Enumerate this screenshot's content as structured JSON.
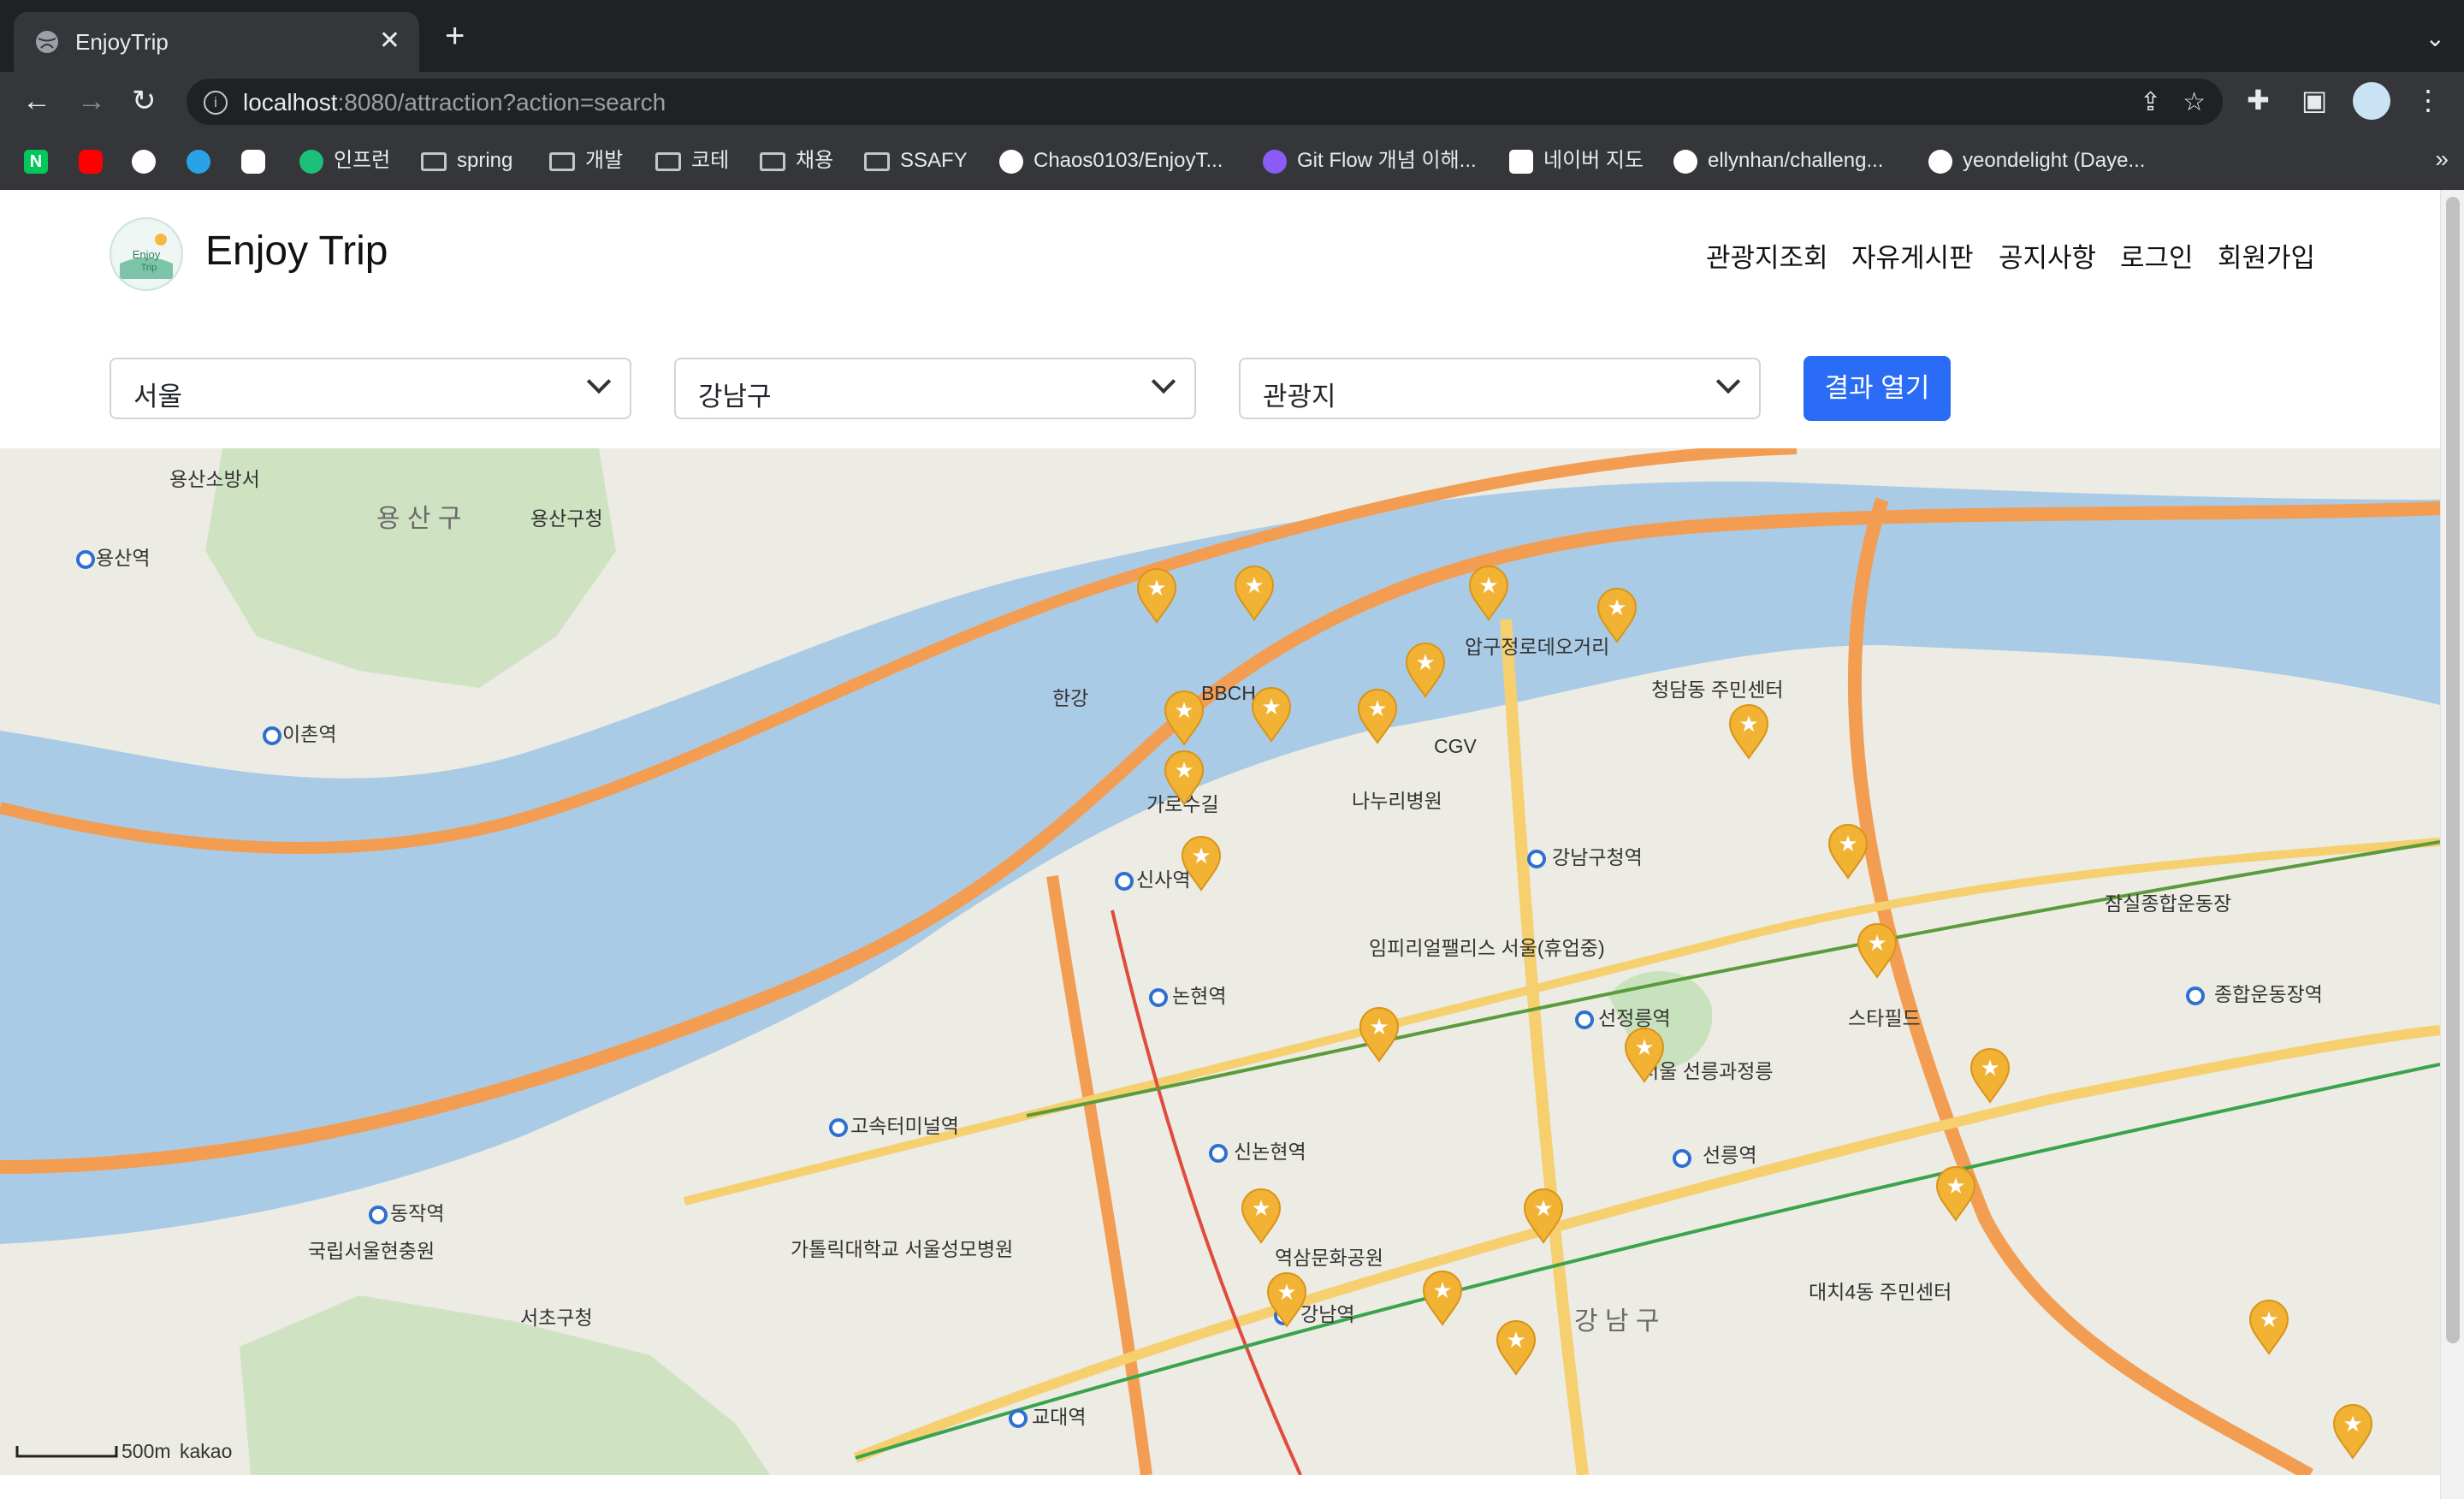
{
  "browser": {
    "tab_title": "EnjoyTrip",
    "url_host": "localhost",
    "url_path": ":8080/attraction?action=search",
    "bookmarks": [
      {
        "label": "",
        "icon": "naver-icon",
        "color": "#03c75a"
      },
      {
        "label": "",
        "icon": "youtube-icon",
        "color": "#ff0000"
      },
      {
        "label": "",
        "icon": "github-icon",
        "color": "#ffffff"
      },
      {
        "label": "",
        "icon": "edge-icon",
        "color": "#2aa3e6"
      },
      {
        "label": "",
        "icon": "app-icon",
        "color": "#ffffff"
      },
      {
        "label": "인프런",
        "icon": "inflearn-icon",
        "color": "#1dc078"
      },
      {
        "label": "spring",
        "icon": "folder-icon"
      },
      {
        "label": "개발",
        "icon": "folder-icon"
      },
      {
        "label": "코테",
        "icon": "folder-icon"
      },
      {
        "label": "채용",
        "icon": "folder-icon"
      },
      {
        "label": "SSAFY",
        "icon": "folder-icon"
      },
      {
        "label": "Chaos0103/EnjoyT...",
        "icon": "github-icon"
      },
      {
        "label": "Git Flow 개념 이해...",
        "icon": "git-icon"
      },
      {
        "label": "네이버 지도",
        "icon": "naver-map-icon"
      },
      {
        "label": "ellynhan/challeng...",
        "icon": "github-icon"
      },
      {
        "label": "yeondelight (Daye...",
        "icon": "github-icon"
      }
    ]
  },
  "site": {
    "title": "Enjoy Trip",
    "nav": [
      "관광지조회",
      "자유게시판",
      "공지사항",
      "로그인",
      "회원가입"
    ]
  },
  "filters": {
    "region": "서울",
    "district": "강남구",
    "content_type": "관광지",
    "submit_label": "결과 열기"
  },
  "map": {
    "provider": "kakao",
    "scale_label": "500m",
    "area_labels": [
      {
        "text": "용 산 구",
        "kind": "district"
      },
      {
        "text": "강 남 구",
        "kind": "district"
      },
      {
        "text": "서초구청",
        "kind": "place"
      },
      {
        "text": "용산구청",
        "kind": "place"
      },
      {
        "text": "용산소방서",
        "kind": "place"
      },
      {
        "text": "용산역",
        "kind": "station"
      },
      {
        "text": "이촌역",
        "kind": "station"
      },
      {
        "text": "신사역",
        "kind": "station"
      },
      {
        "text": "논현역",
        "kind": "station"
      },
      {
        "text": "신논현역",
        "kind": "station"
      },
      {
        "text": "강남구청역",
        "kind": "station"
      },
      {
        "text": "선정릉역",
        "kind": "station"
      },
      {
        "text": "선릉역",
        "kind": "station"
      },
      {
        "text": "종합운동장역",
        "kind": "station"
      },
      {
        "text": "고속터미널역",
        "kind": "station"
      },
      {
        "text": "동작역",
        "kind": "station"
      },
      {
        "text": "교대역",
        "kind": "station"
      },
      {
        "text": "강남역",
        "kind": "station"
      },
      {
        "text": "압구정로데오거리",
        "kind": "place"
      },
      {
        "text": "CGV",
        "kind": "place"
      },
      {
        "text": "BBCH",
        "kind": "place"
      },
      {
        "text": "가로수길",
        "kind": "place"
      },
      {
        "text": "나누리병원",
        "kind": "place"
      },
      {
        "text": "임피리얼팰리스 서울(휴업중)",
        "kind": "place"
      },
      {
        "text": "서울 선릉과정릉",
        "kind": "place"
      },
      {
        "text": "스타필드",
        "kind": "place"
      },
      {
        "text": "잠실종합운동장",
        "kind": "place"
      },
      {
        "text": "국립서울현충원",
        "kind": "place"
      },
      {
        "text": "가톨릭대학교 서울성모병원",
        "kind": "place"
      },
      {
        "text": "청담동 주민센터",
        "kind": "place"
      },
      {
        "text": "대치4동 주민센터",
        "kind": "place"
      },
      {
        "text": "역삼문화공원",
        "kind": "place"
      },
      {
        "text": "한강",
        "kind": "river"
      }
    ],
    "markers": 22
  }
}
